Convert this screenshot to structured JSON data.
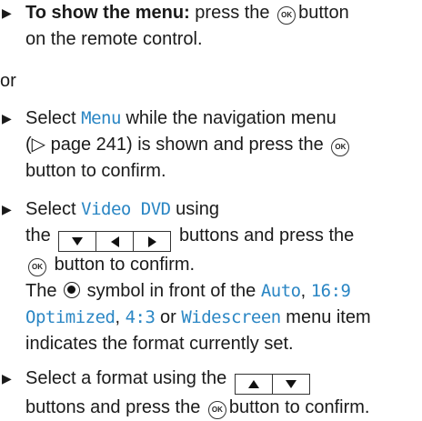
{
  "bullet_glyph": "▶",
  "step1": {
    "label": "To show the menu:",
    "text_a": " press the",
    "ok": "OK",
    "text_b": "button",
    "line2": "on the remote control."
  },
  "or_text": "or",
  "step2": {
    "a": "Select",
    "menu_item": "Menu",
    "b": "while the navigation menu",
    "c": "(▷ page 241) is shown and press the",
    "ok": "OK",
    "d": "button to confirm."
  },
  "step3": {
    "a": "Select",
    "menu_item": "Video DVD",
    "b": "using",
    "c": "the",
    "d": "buttons and press the",
    "ok": "OK",
    "e": "button to confirm.",
    "f": "The",
    "g": "symbol in front of the",
    "opt1": "Auto",
    "comma1": ",",
    "opt2a": "16:9",
    "opt2b": "Optimized",
    "comma2": ",",
    "opt3": "4:3",
    "or_word": "or",
    "opt4": "Widescreen",
    "h": "menu item",
    "i": "indicates the format currently set."
  },
  "step4": {
    "a": "Select a format using the",
    "b": "buttons and press the",
    "ok": "OK",
    "c": "button to confirm."
  },
  "icons": {
    "arrow_down": "arrow-down-icon",
    "arrow_up": "arrow-up-icon",
    "arrow_left": "arrow-left-icon",
    "arrow_right": "arrow-right-icon",
    "ok_button": "ok-button-icon",
    "radio_selected": "radio-selected-icon"
  },
  "colors": {
    "accent": "#2a86c4",
    "text": "#1a1a1a"
  }
}
